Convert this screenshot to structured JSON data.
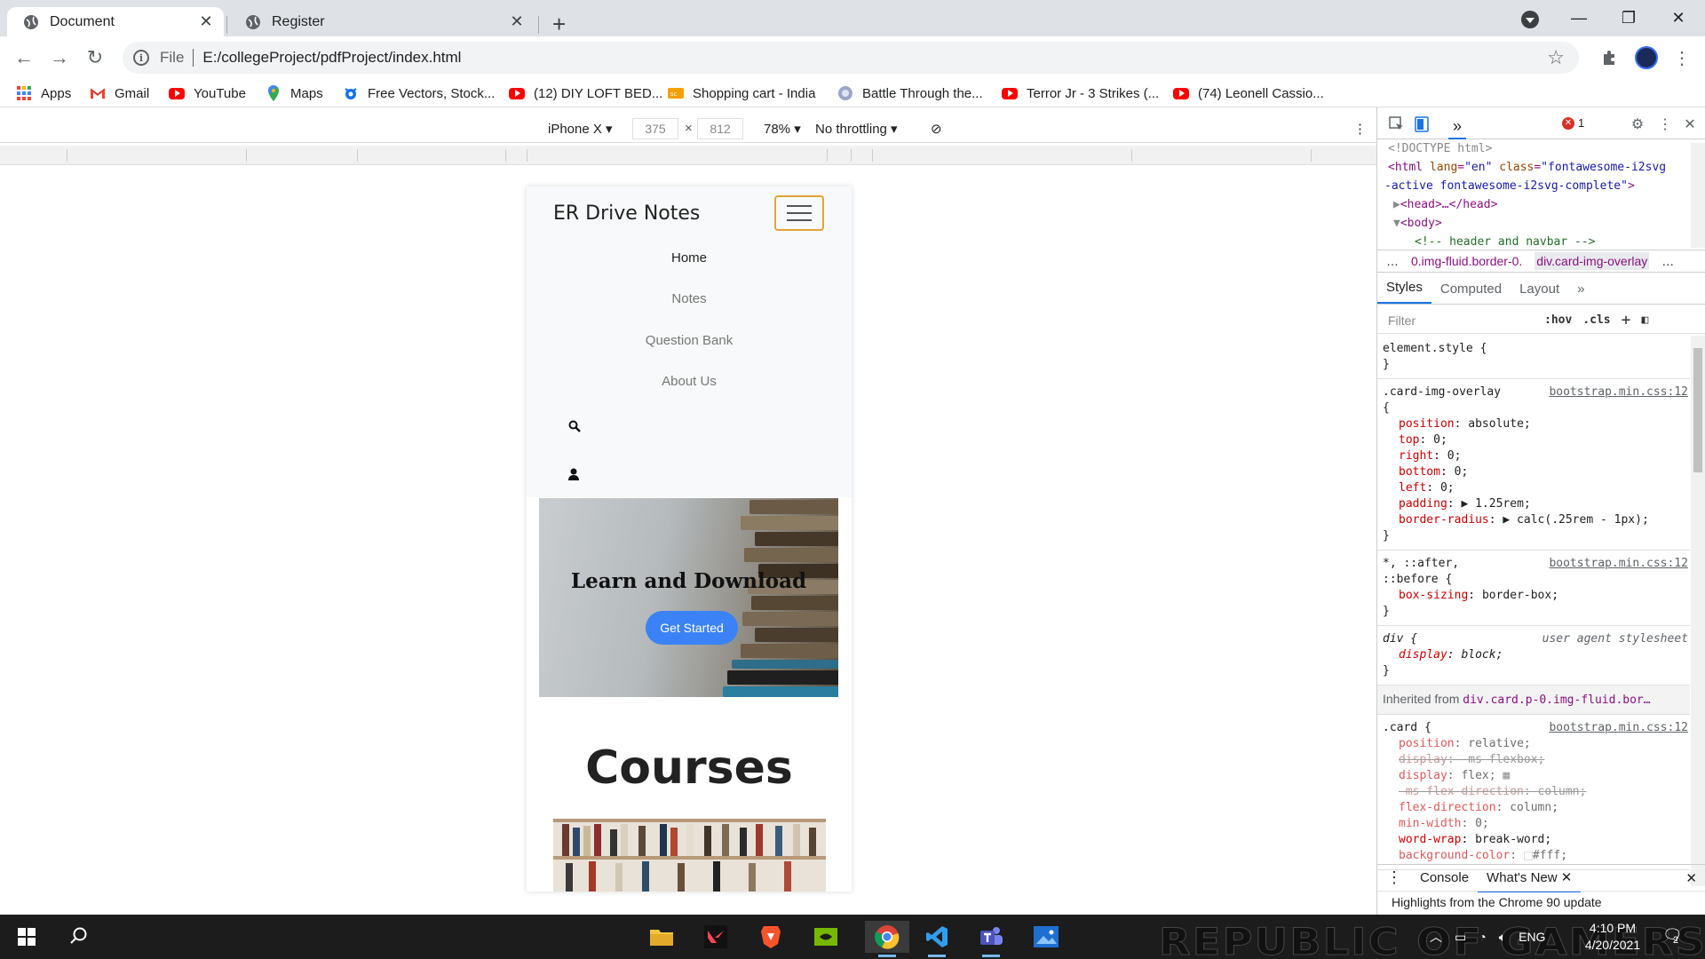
{
  "browser": {
    "tabs": [
      {
        "title": "Document",
        "active": true
      },
      {
        "title": "Register",
        "active": false
      }
    ],
    "url_scheme": "File",
    "url": "E:/collegeProject/pdfProject/index.html",
    "bookmarks": [
      {
        "label": "Apps",
        "icon": "apps-grid-icon"
      },
      {
        "label": "Gmail",
        "icon": "gmail-icon"
      },
      {
        "label": "YouTube",
        "icon": "youtube-icon"
      },
      {
        "label": "Maps",
        "icon": "maps-icon"
      },
      {
        "label": "Free Vectors, Stock...",
        "icon": "freepik-icon"
      },
      {
        "label": "(12) DIY LOFT BED...",
        "icon": "youtube-icon"
      },
      {
        "label": "Shopping cart - India",
        "icon": "shopping-icon"
      },
      {
        "label": "Battle Through the...",
        "icon": "globe-icon"
      },
      {
        "label": "Terror Jr - 3 Strikes (...",
        "icon": "youtube-icon"
      },
      {
        "label": "(74) Leonell Cassio...",
        "icon": "youtube-icon"
      }
    ]
  },
  "device_toolbar": {
    "device": "iPhone X",
    "width": "375",
    "height": "812",
    "zoom": "78%",
    "throttling": "No throttling",
    "times": "×"
  },
  "site": {
    "brand": "ER Drive Notes",
    "nav": [
      "Home",
      "Notes",
      "Question Bank",
      "About Us"
    ],
    "hero_title": "Learn and Download",
    "hero_button": "Get Started",
    "courses_title": "Courses"
  },
  "devtools": {
    "tree": {
      "doctype": "<!DOCTYPE html>",
      "html_open": "<html",
      "lang_attr": "lang",
      "lang_val": "\"en\"",
      "class_attr": "class",
      "class_val": "\"fontawesome-i2svg",
      "class_val2": "-active fontawesome-i2svg-complete\"",
      "gt": ">",
      "head": "<head>…</head>",
      "body": "<body>",
      "comment": "<!-- header and navbar -->"
    },
    "crumbs": [
      "…",
      "0.img-fluid.border-0.",
      "div.card-img-overlay",
      "…"
    ],
    "error_count": "1",
    "style_tabs": [
      "Styles",
      "Computed",
      "Layout"
    ],
    "filter_placeholder": "Filter",
    "hov": ":hov",
    "cls": ".cls",
    "rules": {
      "element_style": "element.style {",
      "close": "}",
      "overlay_sel": ".card-img-overlay",
      "open_brace": "{",
      "src_bootstrap": "bootstrap.min.css:12",
      "overlay_decls": [
        {
          "prop": "position",
          "val": "absolute;"
        },
        {
          "prop": "top",
          "val": "0;"
        },
        {
          "prop": "right",
          "val": "0;"
        },
        {
          "prop": "bottom",
          "val": "0;"
        },
        {
          "prop": "left",
          "val": "0;"
        },
        {
          "prop": "padding",
          "val": "▶ 1.25rem;"
        },
        {
          "prop": "border-radius",
          "val": "▶ calc(.25rem - 1px);"
        }
      ],
      "universal_sel": "*, ::after,",
      "universal_sel2": "::before {",
      "universal_decl": {
        "prop": "box-sizing",
        "val": "border-box;"
      },
      "div_sel": "div {",
      "ua_src": "user agent stylesheet",
      "div_decl": {
        "prop": "display",
        "val": "block;"
      },
      "inherited_label": "Inherited from",
      "inherited_ref": "div.card.p-0.img-fluid.bor…",
      "card_sel": ".card {",
      "card_decls": [
        {
          "prop": "position",
          "val": "relative;",
          "struck": false
        },
        {
          "prop": "display",
          "val": "-ms-flexbox;",
          "struck": true
        },
        {
          "prop": "display",
          "val": "flex;",
          "struck": false
        },
        {
          "prop": "-ms-flex-direction",
          "val": "column;",
          "struck": true
        },
        {
          "prop": "flex-direction",
          "val": "column;",
          "struck": false
        },
        {
          "prop": "min-width",
          "val": "0;",
          "struck": false
        },
        {
          "prop": "word-wrap",
          "val": "break-word;",
          "struck": false
        },
        {
          "prop": "background-color",
          "val": "#fff;",
          "struck": false
        }
      ]
    },
    "drawer_tabs": [
      "Console",
      "What's New"
    ],
    "drawer_text": "Highlights from the Chrome 90 update"
  },
  "taskbar": {
    "watermark": "REPUBLIC OF GAMERS",
    "lang": "ENG",
    "time": "4:10 PM",
    "date": "4/20/2021",
    "notifications": "2"
  },
  "colors": {
    "accent": "#1a73e8",
    "hero_button": "#3b82f6",
    "hamburger_border": "#e3a33a"
  }
}
